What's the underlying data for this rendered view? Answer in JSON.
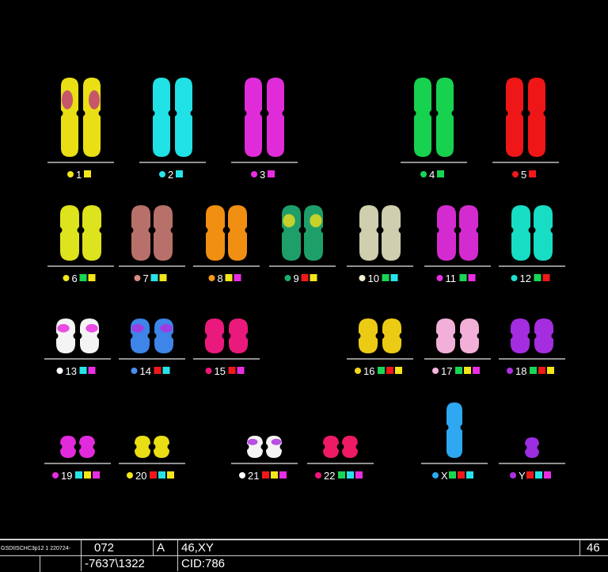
{
  "karyogram": {
    "chromosomes": [
      {
        "label": "1",
        "dot": "#f3e61a",
        "keys": [
          "#f3e61a"
        ],
        "fill": "#e9df14",
        "accent": "#c0407a",
        "shape": "big"
      },
      {
        "label": "2",
        "dot": "#27e3e8",
        "keys": [
          "#27e3e8"
        ],
        "fill": "#20e1e6",
        "shape": "big"
      },
      {
        "label": "3",
        "dot": "#e82ee0",
        "keys": [
          "#e82ee0"
        ],
        "fill": "#e02cd8",
        "shape": "big"
      },
      {
        "label": "4",
        "dot": "#18d653",
        "keys": [
          "#18d653"
        ],
        "fill": "#17d24e",
        "shape": "big"
      },
      {
        "label": "5",
        "dot": "#f01818",
        "keys": [
          "#f01818"
        ],
        "fill": "#ee1616",
        "shape": "big"
      },
      {
        "label": "6",
        "dot": "#f3e61a",
        "keys": [
          "#18d653",
          "#f3e61a"
        ],
        "fill": "#dde31c",
        "shape": "mid"
      },
      {
        "label": "7",
        "dot": "#d98a86",
        "keys": [
          "#27e3e8",
          "#f3e61a"
        ],
        "fill": "#b8706a",
        "shape": "mid"
      },
      {
        "label": "8",
        "dot": "#f59a18",
        "keys": [
          "#f3e61a",
          "#e82ee0"
        ],
        "fill": "#f08f12",
        "shape": "mid"
      },
      {
        "label": "9",
        "dot": "#1cae6e",
        "keys": [
          "#f01818",
          "#f3e61a"
        ],
        "fill": "#1e9f6a",
        "accent": "#e4d820",
        "shape": "mid"
      },
      {
        "label": "10",
        "dot": "#f4f0d0",
        "keys": [
          "#18d653",
          "#27e3e8"
        ],
        "fill": "#cfceae",
        "shape": "mid"
      },
      {
        "label": "11",
        "dot": "#e82ee0",
        "keys": [
          "#18d653",
          "#e82ee0"
        ],
        "fill": "#d42bd0",
        "shape": "mid"
      },
      {
        "label": "12",
        "dot": "#1ee0cf",
        "keys": [
          "#18d653",
          "#f01818"
        ],
        "fill": "#16ddc3",
        "shape": "mid"
      },
      {
        "label": "13",
        "dot": "#ffffff",
        "keys": [
          "#27e3e8",
          "#e82ee0"
        ],
        "fill": "#f4f4f4",
        "accent": "#e82ee0",
        "shape": "small"
      },
      {
        "label": "14",
        "dot": "#4a8ef2",
        "keys": [
          "#f01818",
          "#27e3e8"
        ],
        "fill": "#3f84e8",
        "accent": "#b030e0",
        "shape": "small"
      },
      {
        "label": "15",
        "dot": "#f0167a",
        "keys": [
          "#f01818",
          "#e82ee0"
        ],
        "fill": "#ea1a7c",
        "shape": "small"
      },
      {
        "label": "16",
        "dot": "#f3d81a",
        "keys": [
          "#18d653",
          "#f01818",
          "#f3e61a"
        ],
        "fill": "#eccb14",
        "shape": "small"
      },
      {
        "label": "17",
        "dot": "#f6b6dc",
        "keys": [
          "#18d653",
          "#f3e61a",
          "#e82ee0"
        ],
        "fill": "#f2b0d8",
        "shape": "small"
      },
      {
        "label": "18",
        "dot": "#b030e0",
        "keys": [
          "#18d653",
          "#f01818",
          "#f3e61a"
        ],
        "fill": "#a52de0",
        "shape": "small"
      },
      {
        "label": "19",
        "dot": "#e82ee0",
        "keys": [
          "#27e3e8",
          "#f3e61a",
          "#e82ee0"
        ],
        "fill": "#e22add",
        "shape": "tiny"
      },
      {
        "label": "20",
        "dot": "#f3e61a",
        "keys": [
          "#f01818",
          "#27e3e8",
          "#f3e61a"
        ],
        "fill": "#e9de14",
        "shape": "tiny"
      },
      {
        "label": "21",
        "dot": "#ffffff",
        "keys": [
          "#f01818",
          "#f3e61a",
          "#e82ee0"
        ],
        "fill": "#f4f4f4",
        "accent": "#b030e0",
        "shape": "tiny"
      },
      {
        "label": "22",
        "dot": "#f0167a",
        "keys": [
          "#18d653",
          "#27e3e8",
          "#e82ee0"
        ],
        "fill": "#ee1a66",
        "shape": "tiny"
      },
      {
        "label": "X",
        "dot": "#2aa8f0",
        "keys": [
          "#18d653",
          "#f01818",
          "#27e3e8"
        ],
        "fill": "#2ea8f0",
        "shape": "x"
      },
      {
        "label": "Y",
        "dot": "#b030e0",
        "keys": [
          "#f01818",
          "#27e3e8",
          "#e82ee0"
        ],
        "fill": "#9a2ee0",
        "shape": "y"
      }
    ]
  },
  "info_bar": {
    "slide_id": "GSDIISCHC3p12 1 220724-",
    "case_no": "072",
    "col3": "",
    "col4": "",
    "flag": "A",
    "karyotype": "46,XY",
    "count": "46",
    "coords": "-7637\\1322",
    "cid": "CID:786"
  }
}
